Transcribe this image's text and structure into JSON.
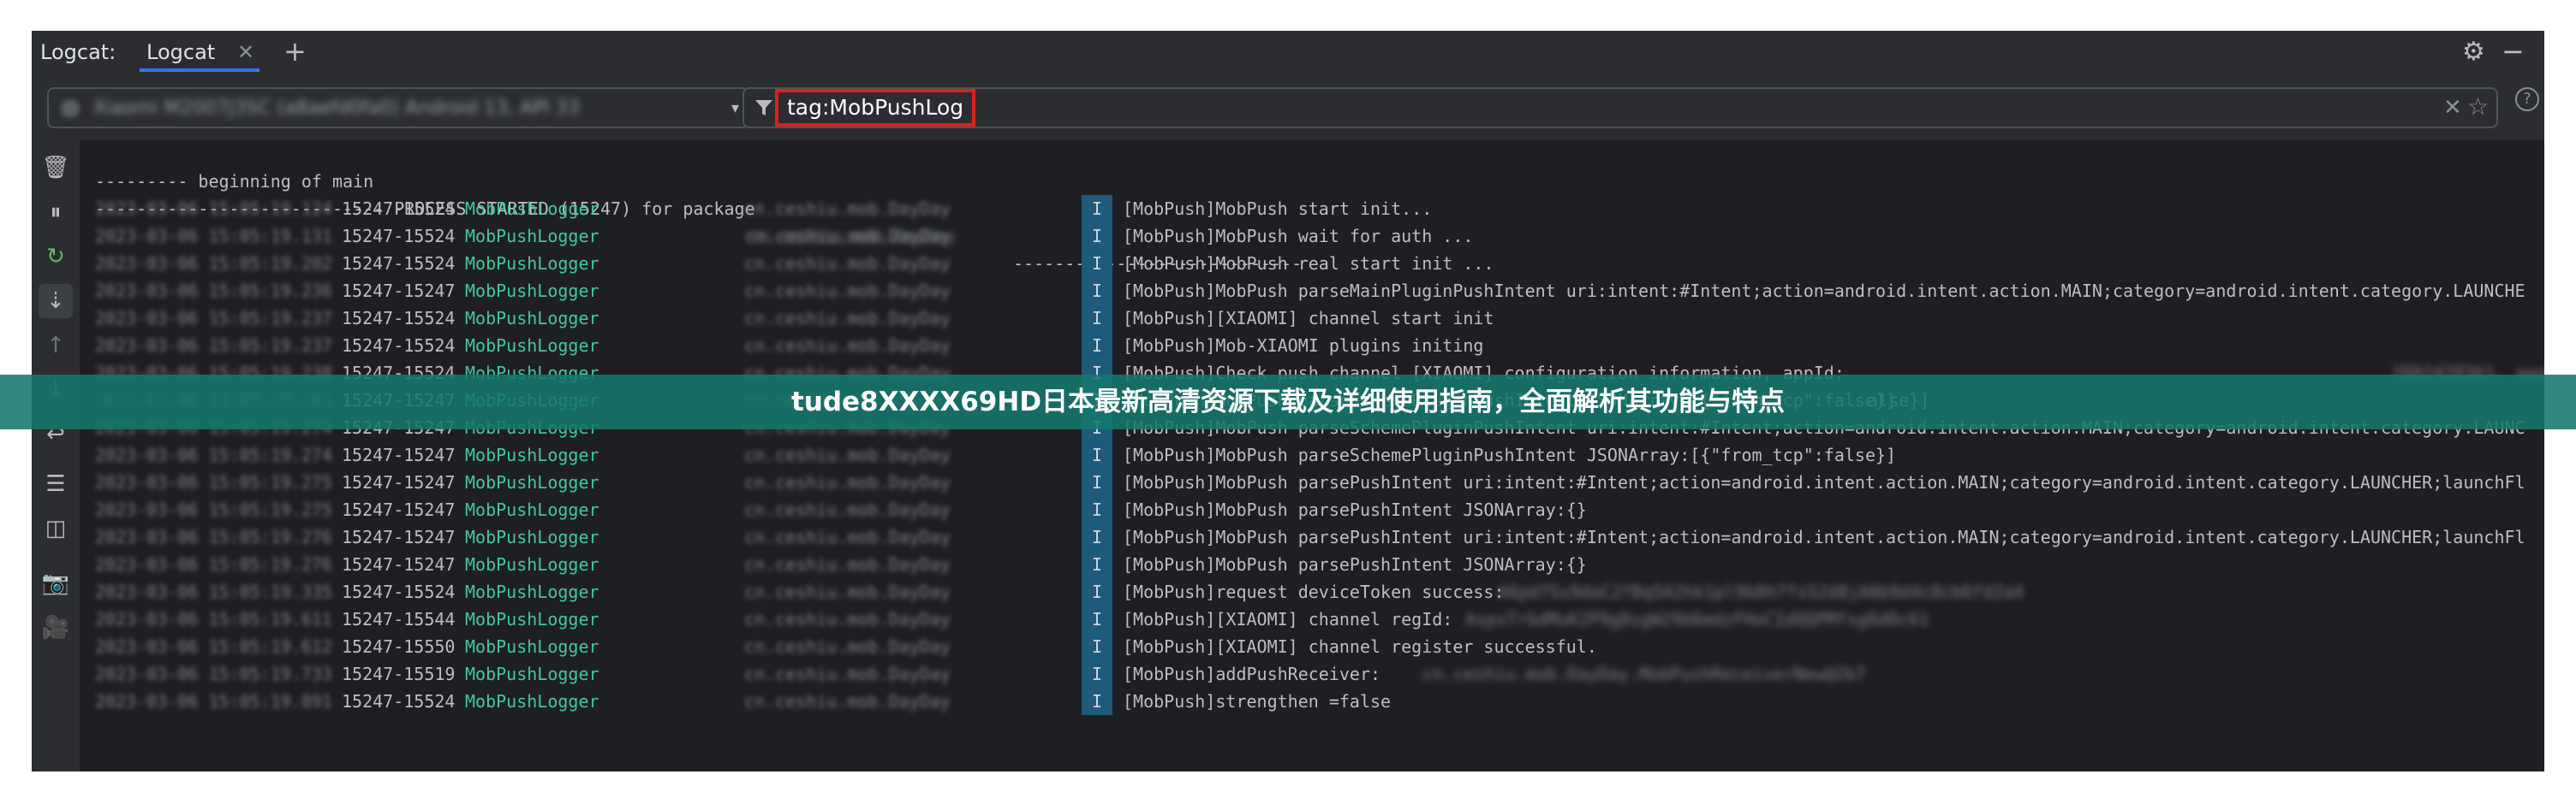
{
  "header": {
    "panel_title": "Logcat:",
    "tab_label": "Logcat",
    "tab_close": "✕",
    "add_tab": "+",
    "settings": "⚙",
    "minimize": "−"
  },
  "toolbar": {
    "device_value": "Xiaomi M2007J3SC (a8aefd0fa0) Android 13, API 33",
    "filter_query": "tag:MobPushLog",
    "clear": "✕",
    "favorite": "☆",
    "help": "?"
  },
  "sidebar": {
    "icons": [
      "trash-icon",
      "pause-icon",
      "restart-icon",
      "scroll-to-end-icon",
      "up-icon",
      "down-icon",
      "soft-wrap-icon",
      "filter-settings-icon",
      "split-view-icon",
      "screenshot-icon",
      "screen-record-icon"
    ]
  },
  "colors": {
    "accent": "#3574f0",
    "tag_color": "#43c6a6",
    "level_bg": "#1f5a7a",
    "overlay": "#16786e",
    "highlight_border": "#e0201b"
  },
  "log": {
    "header_lines": [
      "--------- beginning of main",
      "---------------------------- PROCESS STARTED (15247) for package"
    ],
    "header_pkg": "cn.ceshiu.mob.DayDay",
    "header_tail": "----------------------------",
    "rows": [
      {
        "ts": "2023-03-06 15:05:19.124",
        "pid": "15247-15524",
        "tag": "MobPushLogger",
        "pkg": "cn.ceshiu.mob.DayDay",
        "level": "I",
        "msg": "[MobPush]MobPush start init..."
      },
      {
        "ts": "2023-03-06 15:05:19.131",
        "pid": "15247-15524",
        "tag": "MobPushLogger",
        "pkg": "cn.ceshiu.mob.DayDay",
        "level": "I",
        "msg": "[MobPush]MobPush wait for auth ..."
      },
      {
        "ts": "2023-03-06 15:05:19.202",
        "pid": "15247-15524",
        "tag": "MobPushLogger",
        "pkg": "cn.ceshiu.mob.DayDay",
        "level": "I",
        "msg": "[MobPush]MobPush real start init ..."
      },
      {
        "ts": "2023-03-06 15:05:19.236",
        "pid": "15247-15247",
        "tag": "MobPushLogger",
        "pkg": "cn.ceshiu.mob.DayDay",
        "level": "I",
        "msg": "[MobPush]MobPush parseMainPluginPushIntent uri:intent:#Intent;action=android.intent.action.MAIN;category=android.intent.category.LAUNCHE"
      },
      {
        "ts": "2023-03-06 15:05:19.237",
        "pid": "15247-15524",
        "tag": "MobPushLogger",
        "pkg": "cn.ceshiu.mob.DayDay",
        "level": "I",
        "msg": "[MobPush][XIAOMI] channel start init"
      },
      {
        "ts": "2023-03-06 15:05:19.237",
        "pid": "15247-15524",
        "tag": "MobPushLogger",
        "pkg": "cn.ceshiu.mob.DayDay",
        "level": "I",
        "msg": "[MobPush]Mob-XIAOMI plugins initing"
      },
      {
        "ts": "2023-03-06 15:05:19.238",
        "pid": "15247-15524",
        "tag": "MobPushLogger",
        "pkg": "cn.ceshiu.mob.DayDay",
        "level": "I",
        "msg": "[MobPush]Check push channel [XIAOMI] configuration information, appId:"
      },
      {
        "ts": "2023-03-06 15:05:19.261",
        "pid": "15247-15247",
        "tag": "MobPushLogger",
        "pkg": "cn.ceshiu.mob.DayDay",
        "level": "I",
        "msg": "[MobPush]MobPush parseSchemePluginPushIntent JSONArray:[{\"from_tcp\":false}]"
      },
      {
        "ts": "2023-03-06 15:05:19.274",
        "pid": "15247-15247",
        "tag": "MobPushLogger",
        "pkg": "cn.ceshiu.mob.DayDay",
        "level": "I",
        "msg": "[MobPush]MobPush parseSchemePluginPushIntent uri:intent:#Intent;action=android.intent.action.MAIN;category=android.intent.category.LAUNC"
      },
      {
        "ts": "2023-03-06 15:05:19.274",
        "pid": "15247-15247",
        "tag": "MobPushLogger",
        "pkg": "cn.ceshiu.mob.DayDay",
        "level": "I",
        "msg": "[MobPush]MobPush parseSchemePluginPushIntent JSONArray:[{\"from_tcp\":false}]"
      },
      {
        "ts": "2023-03-06 15:05:19.275",
        "pid": "15247-15247",
        "tag": "MobPushLogger",
        "pkg": "cn.ceshiu.mob.DayDay",
        "level": "I",
        "msg": "[MobPush]MobPush parsePushIntent uri:intent:#Intent;action=android.intent.action.MAIN;category=android.intent.category.LAUNCHER;launchFl"
      },
      {
        "ts": "2023-03-06 15:05:19.275",
        "pid": "15247-15247",
        "tag": "MobPushLogger",
        "pkg": "cn.ceshiu.mob.DayDay",
        "level": "I",
        "msg": "[MobPush]MobPush parsePushIntent JSONArray:{}"
      },
      {
        "ts": "2023-03-06 15:05:19.276",
        "pid": "15247-15247",
        "tag": "MobPushLogger",
        "pkg": "cn.ceshiu.mob.DayDay",
        "level": "I",
        "msg": "[MobPush]MobPush parsePushIntent uri:intent:#Intent;action=android.intent.action.MAIN;category=android.intent.category.LAUNCHER;launchFl"
      },
      {
        "ts": "2023-03-06 15:05:19.276",
        "pid": "15247-15247",
        "tag": "MobPushLogger",
        "pkg": "cn.ceshiu.mob.DayDay",
        "level": "I",
        "msg": "[MobPush]MobPush parsePushIntent JSONArray:{}"
      },
      {
        "ts": "2023-03-06 15:05:19.335",
        "pid": "15247-15524",
        "tag": "MobPushLogger",
        "pkg": "cn.ceshiu.mob.DayDay",
        "level": "I",
        "msg": "[MobPush]request deviceToken success:"
      },
      {
        "ts": "2023-03-06 15:05:19.611",
        "pid": "15247-15544",
        "tag": "MobPushLogger",
        "pkg": "cn.ceshiu.mob.DayDay",
        "level": "I",
        "msg": "[MobPush][XIAOMI] channel regId:"
      },
      {
        "ts": "2023-03-06 15:05:19.612",
        "pid": "15247-15550",
        "tag": "MobPushLogger",
        "pkg": "cn.ceshiu.mob.DayDay",
        "level": "I",
        "msg": "[MobPush][XIAOMI] channel register successful."
      },
      {
        "ts": "2023-03-06 15:05:19.733",
        "pid": "15247-15519",
        "tag": "MobPushLogger",
        "pkg": "cn.ceshiu.mob.DayDay",
        "level": "I",
        "msg": "[MobPush]addPushReceiver:"
      },
      {
        "ts": "2023-03-06 15:05:19.891",
        "pid": "15247-15524",
        "tag": "MobPushLogger",
        "pkg": "cn.ceshiu.mob.DayDay",
        "level": "I",
        "msg": "[MobPush]strengthen =false"
      }
    ],
    "row6_tail_blur": "2882428361, appKey:",
    "row7_tail": "alse}]",
    "row14_tail_blur": "A6pd7Ss9daC2fBq5A2hk1pl9b0h7fsS2d8jA8b9d4c8cb6fd2a4",
    "row15_tail_blur": "AspsTrbdMuK2P9g8sgW29b6mdzFHoCIdQQPMfsg6d0c61",
    "row17_tail_blur": "cn.ceshiu.mob.DayDay.MobPushReceiverNew@2b7"
  },
  "overlay": {
    "text": "tude8XXXX69HD日本最新高清资源下载及详细使用指南，全面解析其功能与特点"
  }
}
